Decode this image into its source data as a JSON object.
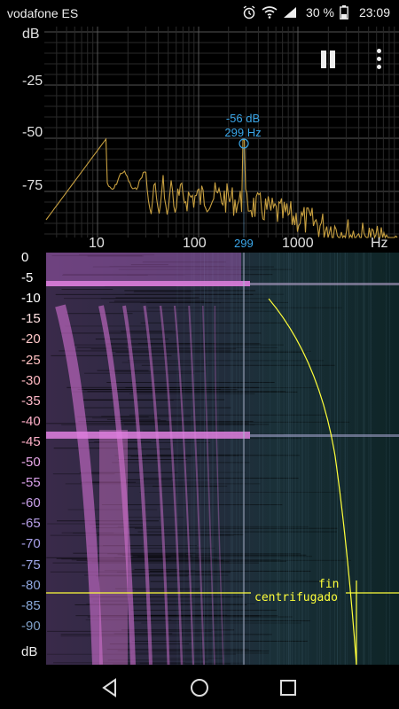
{
  "status": {
    "carrier": "vodafone ES",
    "battery_percent": "30 %",
    "time": "23:09",
    "icons": [
      "alarm-icon",
      "wifi-icon",
      "signal-icon",
      "battery-icon"
    ]
  },
  "spectrum": {
    "y_unit": "dB",
    "y_ticks": [
      "-25",
      "-50",
      "-75"
    ],
    "x_ticks": [
      "10",
      "100",
      "1000"
    ],
    "x_unit": "Hz",
    "peak": {
      "db": "-56 dB",
      "freq": "299 Hz",
      "x_label": "299"
    },
    "controls": {
      "pause_icon": "pause-icon",
      "menu_icon": "more-vert-icon"
    },
    "colors": {
      "trace": "#c8a040",
      "peak": "#3aa6e8",
      "grid": "#3a3a3a"
    }
  },
  "spectrogram": {
    "time_ticks": [
      "0",
      "-5",
      "-10",
      "-15",
      "-20",
      "-25",
      "-30",
      "-35",
      "-40",
      "-45",
      "-50",
      "-55",
      "-60",
      "-65",
      "-70",
      "-75",
      "-80",
      "-85",
      "-90"
    ],
    "bottom_unit": "dB",
    "annotation_line1": "fin",
    "annotation_line2": "centrifugado",
    "colors": {
      "annotation": "#ffff3a",
      "band": "#e080e0",
      "background": "#0a1a1c"
    }
  },
  "nav": {
    "back_icon": "back-icon",
    "home_icon": "home-icon",
    "recents_icon": "recents-icon"
  }
}
